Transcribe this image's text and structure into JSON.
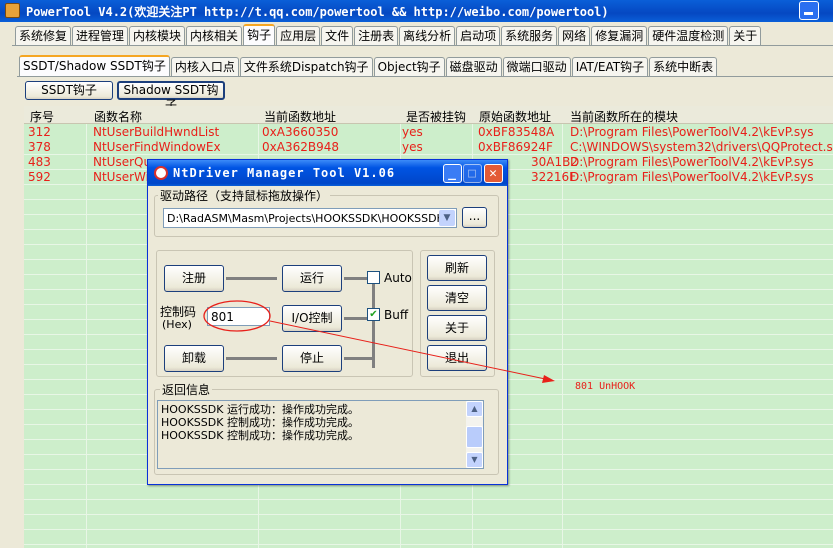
{
  "window": {
    "title": "PowerTool V4.2(欢迎关注PT http://t.qq.com/powertool && http://weibo.com/powertool)"
  },
  "main_tabs": [
    "系统修复",
    "进程管理",
    "内核模块",
    "内核相关",
    "钩子",
    "应用层",
    "文件",
    "注册表",
    "离线分析",
    "启动项",
    "系统服务",
    "网络",
    "修复漏洞",
    "硬件温度检测",
    "关于"
  ],
  "sub_tabs": [
    "SSDT/Shadow SSDT钩子",
    "内核入口点",
    "文件系统Dispatch钩子",
    "Object钩子",
    "磁盘驱动",
    "微端口驱动",
    "IAT/EAT钩子",
    "系统中断表"
  ],
  "buttons": {
    "ssdt": "SSDT钩子",
    "shadow_ssdt": "Shadow SSDT钩子"
  },
  "table": {
    "columns": [
      "序号",
      "函数名称",
      "当前函数地址",
      "是否被挂钩",
      "原始函数地址",
      "当前函数所在的模块"
    ],
    "rows": [
      [
        "312",
        "NtUserBuildHwndList",
        "0xA3660350",
        "yes",
        "0xBF83548A",
        "D:\\Program Files\\PowerToolV4.2\\kEvP.sys"
      ],
      [
        "378",
        "NtUserFindWindowEx",
        "0xA362B948",
        "yes",
        "0xBF86924F",
        "C:\\WINDOWS\\system32\\drivers\\QQProtect.sys"
      ],
      [
        "483",
        "NtUserQu",
        "",
        "",
        "30A1B2",
        "D:\\Program Files\\PowerToolV4.2\\kEvP.sys"
      ],
      [
        "592",
        "NtUserWi",
        "",
        "",
        "32216F",
        "D:\\Program Files\\PowerToolV4.2\\kEvP.sys"
      ]
    ]
  },
  "dialog": {
    "title": "NtDriver Manager Tool V1.06",
    "path_group_label": "驱动路径（支持鼠标拖放操作）",
    "path_value": "D:\\RadASM\\Masm\\Projects\\HOOKSSDK\\HOOKSSDK.s",
    "browse_label": "...",
    "register_label": "注册",
    "run_label": "运行",
    "auto_label": "Auto",
    "auto_checked": false,
    "control_code_label": "控制码",
    "hex_label": "(Hex)",
    "control_code_value": "801",
    "io_control_label": "I/O控制",
    "buff_label": "Buff",
    "buff_checked": true,
    "unload_label": "卸载",
    "stop_label": "停止",
    "refresh_label": "刷新",
    "clear_label": "清空",
    "about_label": "关于",
    "exit_label": "退出",
    "return_group_label": "返回信息",
    "log_lines": [
      "HOOKSSDK 运行成功：操作成功完成。",
      "HOOKSSDK 控制成功：操作成功完成。",
      "HOOKSSDK 控制成功：操作成功完成。"
    ]
  },
  "annotation": {
    "text": "801 UnHOOK",
    "color": "#e8201a"
  },
  "colors": {
    "list_bg": "#cdeecb",
    "hooked_text": "#e8201a",
    "title_blue": "#0054e3"
  }
}
